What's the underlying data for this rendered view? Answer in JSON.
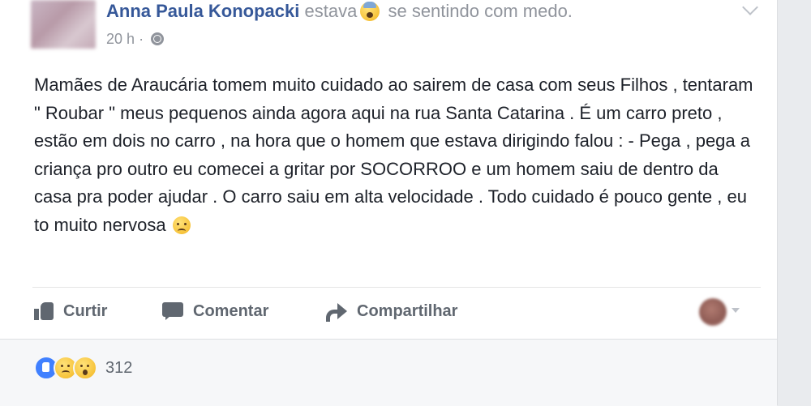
{
  "post": {
    "author": "Anna Paula Konopacki",
    "feeling_prefix": "estava",
    "feeling_text": "se sentindo com medo.",
    "feeling_icon": "fearful-face-emoji",
    "timestamp": "20 h",
    "separator": "·",
    "privacy_icon": "globe-icon",
    "body_text": "Mamães de Araucária tomem muito cuidado ao sairem de casa com seus Filhos , tentaram \" Roubar \" meus pequenos ainda agora aqui na rua Santa Catarina . É um carro preto , estão em dois no carro , na hora que o homem que estava dirigindo falou : - Pega , pega a criança pro outro eu comecei a gritar por SOCORROO e um homem saiu de dentro da casa pra poder ajudar . O carro saiu em alta velocidade . Todo cuidado é pouco gente , eu to muito nervosa",
    "body_end_icon": "crying-face-emoji"
  },
  "actions": {
    "like_label": "Curtir",
    "comment_label": "Comentar",
    "share_label": "Compartilhar"
  },
  "reactions": {
    "icons": [
      "like-reaction",
      "sad-reaction",
      "wow-reaction"
    ],
    "count": "312"
  },
  "colors": {
    "author_link": "#365899",
    "secondary_text": "#90949c",
    "body_text": "#1d2129",
    "action_text": "#606770",
    "like_blue": "#4080ff"
  }
}
